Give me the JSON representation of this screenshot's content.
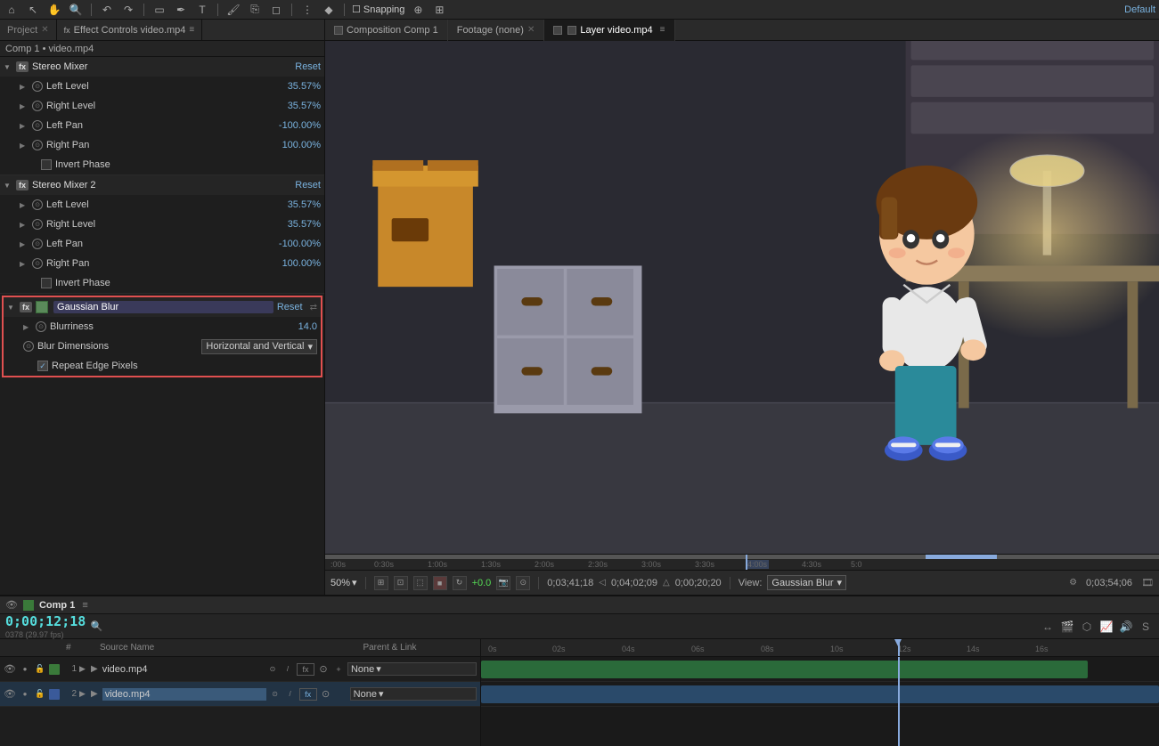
{
  "toolbar": {
    "snapping_label": "Snapping",
    "default_label": "Default"
  },
  "left_panel": {
    "tabs": [
      {
        "label": "Project",
        "close": true
      },
      {
        "label": "Effect Controls video.mp4",
        "active": true
      }
    ],
    "breadcrumb": "Comp 1 • video.mp4",
    "stereo_mixer_1": {
      "name": "Stereo Mixer",
      "reset": "Reset",
      "params": [
        {
          "name": "Left Level",
          "value": "35.57%"
        },
        {
          "name": "Right Level",
          "value": "35.57%"
        },
        {
          "name": "Left Pan",
          "value": "-100.00%"
        },
        {
          "name": "Right Pan",
          "value": "100.00%"
        }
      ],
      "invert_phase": "Invert Phase"
    },
    "stereo_mixer_2": {
      "name": "Stereo Mixer 2",
      "reset": "Reset",
      "params": [
        {
          "name": "Left Level",
          "value": "35.57%"
        },
        {
          "name": "Right Level",
          "value": "35.57%"
        },
        {
          "name": "Left Pan",
          "value": "-100.00%"
        },
        {
          "name": "Right Pan",
          "value": "100.00%"
        }
      ],
      "invert_phase": "Invert Phase"
    },
    "gaussian_blur": {
      "name": "Gaussian Blur",
      "reset": "Reset",
      "blurriness_label": "Blurriness",
      "blurriness_value": "14.0",
      "blur_dimensions_label": "Blur Dimensions",
      "blur_dimensions_value": "Horizontal and Vertical",
      "repeat_edge_label": "Repeat Edge Pixels"
    }
  },
  "viewer": {
    "tabs": [
      {
        "label": "Composition Comp 1",
        "active": true
      },
      {
        "label": "Footage (none)"
      },
      {
        "label": "Layer video.mp4",
        "active": true
      }
    ],
    "comp_tab": "Composition Comp 1",
    "footage_tab": "Footage (none)",
    "layer_tab": "Layer video.mp4"
  },
  "viewer_controls": {
    "zoom": "50%",
    "timecodes": [
      {
        "label": "0;03;41;18"
      },
      {
        "label": "0;04;02;09"
      },
      {
        "label": "0;00;20;20"
      }
    ],
    "plus_value": "+0.0",
    "current_time": "0;03;54;06",
    "view_label": "View:",
    "view_value": "Gaussian Blur"
  },
  "timeline_ruler": {
    "markers": [
      "0s",
      "0:30s",
      "1:00s",
      "1:30s",
      "2:00s",
      "2:30s",
      "3:00s",
      "3:30s",
      "4:00s",
      "4:30s",
      "5:0"
    ]
  },
  "comp_panel": {
    "name": "Comp 1",
    "timecode": "0;00;12;18",
    "fps": "0378 (29.97 fps)"
  },
  "layers": [
    {
      "num": "1",
      "name": "video.mp4",
      "color": "#3a7a3a",
      "has_fx": true
    },
    {
      "num": "2",
      "name": "video.mp4",
      "color": "#3a5a9a",
      "has_fx": true,
      "selected": true
    }
  ],
  "layer_columns": {
    "headers": [
      "",
      "",
      "",
      "#",
      "",
      "Source Name",
      "",
      "",
      "",
      "fx",
      "",
      "",
      "Parent & Link"
    ]
  },
  "track_ruler": {
    "ticks": [
      "0s",
      "02s",
      "04s",
      "06s",
      "08s",
      "10s",
      "12s",
      "14s",
      "16s"
    ]
  },
  "colors": {
    "accent_blue": "#7ab3e0",
    "highlight_red": "#e05050",
    "timecode_green": "#55dddd"
  }
}
